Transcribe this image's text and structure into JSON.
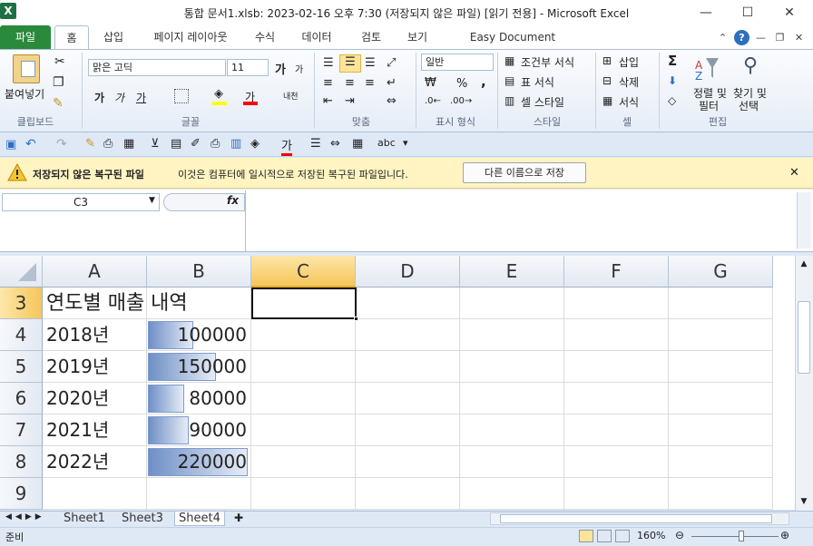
{
  "window": {
    "app_icon": "X",
    "title": "통합 문서1.xlsb: 2023-02-16 오후 7:30 (저장되지 않은 파일)  [읽기 전용]  -  Microsoft Excel",
    "minimize": "—",
    "maximize": "☐",
    "close": "✕"
  },
  "tabs": {
    "file": "파일",
    "items": [
      "홈",
      "삽입",
      "페이지 레이아웃",
      "수식",
      "데이터",
      "검토",
      "보기",
      "Easy Document Creator"
    ],
    "active": "홈"
  },
  "ribbon": {
    "clipboard": {
      "paste": "붙여넣기",
      "label": "클립보드"
    },
    "font": {
      "name": "맑은 고딕",
      "size": "11",
      "label": "글꼴",
      "bold": "가",
      "italic": "가",
      "underline": "가",
      "grow": "가",
      "shrink": "가",
      "phonetic": "내천",
      "fill_color": "#ffff00",
      "font_color": "#ff0000",
      "color_glyph": "가"
    },
    "alignment": {
      "label": "맞춤"
    },
    "number": {
      "format": "일반",
      "label": "표시 형식",
      "percent": "%",
      "comma": ","
    },
    "styles": {
      "conditional": "조건부 서식",
      "table": "표 서식",
      "cell": "셀 스타일",
      "label": "스타일"
    },
    "cells": {
      "insert": "삽입",
      "delete": "삭제",
      "format": "서식",
      "label": "셀"
    },
    "editing": {
      "sum": "Σ",
      "sort_filter_1": "정렬 및",
      "sort_filter_2": "필터",
      "find_select_1": "찾기 및",
      "find_select_2": "선택",
      "label": "편집"
    }
  },
  "message_bar": {
    "title": "저장되지 않은 복구된 파일",
    "text": "이것은 컴퓨터에 일시적으로 저장된 복구된 파일입니다.",
    "button": "다른 이름으로 저장",
    "close": "✕"
  },
  "formula_bar": {
    "name_box": "C3",
    "fx": "fx",
    "value": ""
  },
  "grid": {
    "columns": [
      "A",
      "B",
      "C",
      "D",
      "E",
      "F",
      "G"
    ],
    "selected_column": "C",
    "rows": [
      {
        "num": "3",
        "a": "연도별 매출 내역",
        "b": "",
        "bar": null
      },
      {
        "num": "4",
        "a": "2018년",
        "b": "100000",
        "bar": 0.455
      },
      {
        "num": "5",
        "a": "2019년",
        "b": "150000",
        "bar": 0.682
      },
      {
        "num": "6",
        "a": "2020년",
        "b": "80000",
        "bar": 0.364
      },
      {
        "num": "7",
        "a": "2021년",
        "b": "90000",
        "bar": 0.409
      },
      {
        "num": "8",
        "a": "2022년",
        "b": "220000",
        "bar": 1.0
      },
      {
        "num": "9",
        "a": "",
        "b": "",
        "bar": null
      }
    ],
    "selected_row": "3",
    "active_cell": "C3"
  },
  "sheets": {
    "tabs": [
      "Sheet1",
      "Sheet3",
      "Sheet4"
    ],
    "active": "Sheet4"
  },
  "status": {
    "ready": "준비",
    "zoom": "160%"
  }
}
